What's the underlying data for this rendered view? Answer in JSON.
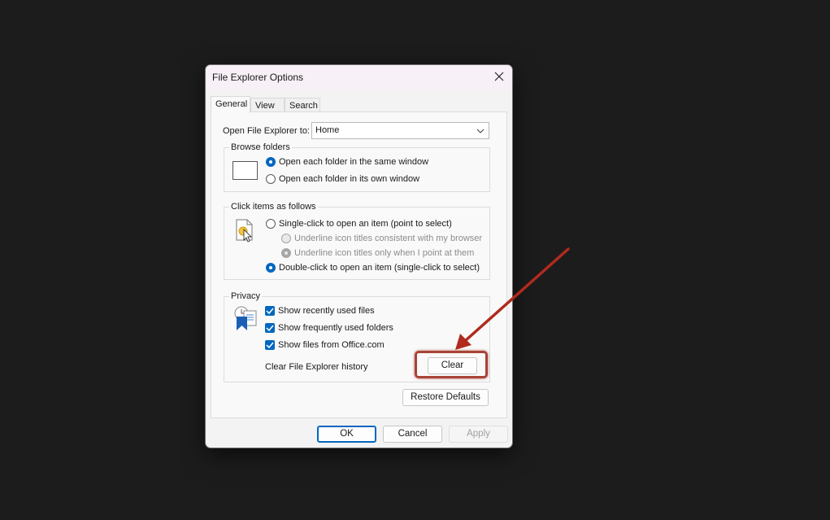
{
  "window": {
    "title": "File Explorer Options"
  },
  "tabs": [
    {
      "label": "General",
      "active": true
    },
    {
      "label": "View",
      "active": false
    },
    {
      "label": "Search",
      "active": false
    }
  ],
  "open_to": {
    "label": "Open File Explorer to:",
    "value": "Home"
  },
  "browse_folders": {
    "legend": "Browse folders",
    "options": [
      {
        "label": "Open each folder in the same window",
        "selected": true
      },
      {
        "label": "Open each folder in its own window",
        "selected": false
      }
    ]
  },
  "click_items": {
    "legend": "Click items as follows",
    "single_click": {
      "label": "Single-click to open an item (point to select)",
      "selected": false
    },
    "underline_browser": {
      "label": "Underline icon titles consistent with my browser",
      "selected": false,
      "disabled": true
    },
    "underline_point": {
      "label": "Underline icon titles only when I point at them",
      "selected": true,
      "disabled": true
    },
    "double_click": {
      "label": "Double-click to open an item (single-click to select)",
      "selected": true
    }
  },
  "privacy": {
    "legend": "Privacy",
    "checks": [
      {
        "label": "Show recently used files",
        "checked": true
      },
      {
        "label": "Show frequently used folders",
        "checked": true
      },
      {
        "label": "Show files from Office.com",
        "checked": true
      }
    ],
    "clear_label": "Clear File Explorer history",
    "clear_button": "Clear"
  },
  "restore_defaults": "Restore Defaults",
  "footer": {
    "ok": "OK",
    "cancel": "Cancel",
    "apply": "Apply"
  },
  "colors": {
    "accent": "#0067c0",
    "annotation": "#a84336"
  }
}
